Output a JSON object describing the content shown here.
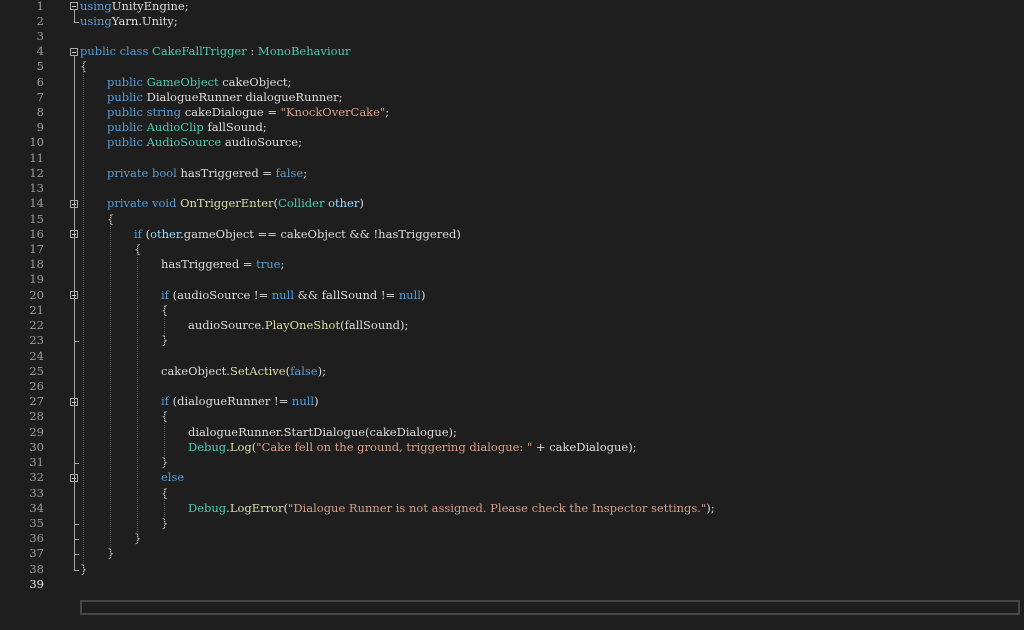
{
  "editor": {
    "current_line": 39,
    "colors": {
      "background": "#1e1e1e",
      "keyword": "#569cd6",
      "type": "#4ec9b0",
      "method": "#dcdcaa",
      "string": "#d69d85",
      "parameter": "#9cdcfe",
      "text": "#dcdcdc",
      "line_number": "#9a9a9a"
    },
    "lines": [
      {
        "n": "1",
        "indent": 0,
        "tokens": [
          [
            "kw",
            "using"
          ],
          [
            "",
            "UnityEngine;"
          ]
        ]
      },
      {
        "n": "2",
        "indent": 0,
        "tokens": [
          [
            "kw",
            "using"
          ],
          [
            "",
            "Yarn.Unity;"
          ]
        ]
      },
      {
        "n": "3",
        "indent": 0,
        "tokens": []
      },
      {
        "n": "4",
        "indent": 0,
        "tokens": [
          [
            "kw",
            "public class "
          ],
          [
            "ty",
            "CakeFallTrigger"
          ],
          [
            "",
            " : "
          ],
          [
            "ty",
            "MonoBehaviour"
          ]
        ]
      },
      {
        "n": "5",
        "indent": 0,
        "tokens": [
          [
            "",
            "{"
          ]
        ]
      },
      {
        "n": "6",
        "indent": 1,
        "tokens": [
          [
            "kw",
            "public "
          ],
          [
            "ty",
            "GameObject"
          ],
          [
            "",
            " cakeObject;"
          ]
        ]
      },
      {
        "n": "7",
        "indent": 1,
        "tokens": [
          [
            "kw",
            "public "
          ],
          [
            "",
            "DialogueRunner dialogueRunner;"
          ]
        ]
      },
      {
        "n": "8",
        "indent": 1,
        "tokens": [
          [
            "kw",
            "public string "
          ],
          [
            "",
            "cakeDialogue = "
          ],
          [
            "st",
            "\"KnockOverCake\""
          ],
          [
            "",
            ";"
          ]
        ]
      },
      {
        "n": "9",
        "indent": 1,
        "tokens": [
          [
            "kw",
            "public "
          ],
          [
            "ty",
            "AudioClip"
          ],
          [
            "",
            " fallSound;"
          ]
        ]
      },
      {
        "n": "10",
        "indent": 1,
        "tokens": [
          [
            "kw",
            "public "
          ],
          [
            "ty",
            "AudioSource"
          ],
          [
            "",
            " audioSource;"
          ]
        ]
      },
      {
        "n": "11",
        "indent": 0,
        "tokens": []
      },
      {
        "n": "12",
        "indent": 1,
        "tokens": [
          [
            "kw",
            "private bool "
          ],
          [
            "",
            "hasTriggered = "
          ],
          [
            "kw",
            "false"
          ],
          [
            "",
            ";"
          ]
        ]
      },
      {
        "n": "13",
        "indent": 0,
        "tokens": []
      },
      {
        "n": "14",
        "indent": 1,
        "tokens": [
          [
            "kw",
            "private void "
          ],
          [
            "fn",
            "OnTriggerEnter"
          ],
          [
            "",
            "("
          ],
          [
            "ty",
            "Collider"
          ],
          [
            "",
            " "
          ],
          [
            "pa",
            "other"
          ],
          [
            "",
            ")"
          ]
        ]
      },
      {
        "n": "15",
        "indent": 1,
        "tokens": [
          [
            "",
            "{"
          ]
        ]
      },
      {
        "n": "16",
        "indent": 2,
        "tokens": [
          [
            "kw",
            "if"
          ],
          [
            "",
            " ("
          ],
          [
            "pa",
            "other"
          ],
          [
            "",
            ".gameObject == cakeObject && !hasTriggered)"
          ]
        ]
      },
      {
        "n": "17",
        "indent": 2,
        "tokens": [
          [
            "",
            "{"
          ]
        ]
      },
      {
        "n": "18",
        "indent": 3,
        "tokens": [
          [
            "",
            "hasTriggered = "
          ],
          [
            "kw",
            "true"
          ],
          [
            "",
            ";"
          ]
        ]
      },
      {
        "n": "19",
        "indent": 0,
        "tokens": []
      },
      {
        "n": "20",
        "indent": 3,
        "tokens": [
          [
            "kw",
            "if"
          ],
          [
            "",
            " (audioSource != "
          ],
          [
            "kw",
            "null"
          ],
          [
            "",
            " && fallSound != "
          ],
          [
            "kw",
            "null"
          ],
          [
            "",
            ")"
          ]
        ]
      },
      {
        "n": "21",
        "indent": 3,
        "tokens": [
          [
            "",
            "{"
          ]
        ]
      },
      {
        "n": "22",
        "indent": 4,
        "tokens": [
          [
            "",
            "audioSource."
          ],
          [
            "fn",
            "PlayOneShot"
          ],
          [
            "",
            "(fallSound);"
          ]
        ]
      },
      {
        "n": "23",
        "indent": 3,
        "tokens": [
          [
            "",
            "}"
          ]
        ]
      },
      {
        "n": "24",
        "indent": 0,
        "tokens": []
      },
      {
        "n": "25",
        "indent": 3,
        "tokens": [
          [
            "",
            "cakeObject."
          ],
          [
            "fn",
            "SetActive"
          ],
          [
            "",
            "("
          ],
          [
            "kw",
            "false"
          ],
          [
            "",
            ");"
          ]
        ]
      },
      {
        "n": "26",
        "indent": 0,
        "tokens": []
      },
      {
        "n": "27",
        "indent": 3,
        "tokens": [
          [
            "kw",
            "if"
          ],
          [
            "",
            " (dialogueRunner != "
          ],
          [
            "kw",
            "null"
          ],
          [
            "",
            ")"
          ]
        ]
      },
      {
        "n": "28",
        "indent": 3,
        "tokens": [
          [
            "",
            "{"
          ]
        ]
      },
      {
        "n": "29",
        "indent": 4,
        "tokens": [
          [
            "",
            "dialogueRunner.StartDialogue(cakeDialogue);"
          ]
        ]
      },
      {
        "n": "30",
        "indent": 4,
        "tokens": [
          [
            "ty",
            "Debug"
          ],
          [
            "",
            "."
          ],
          [
            "fn",
            "Log"
          ],
          [
            "",
            "("
          ],
          [
            "st",
            "\"Cake fell on the ground, triggering dialogue: \""
          ],
          [
            "",
            " + cakeDialogue);"
          ]
        ]
      },
      {
        "n": "31",
        "indent": 3,
        "tokens": [
          [
            "",
            "}"
          ]
        ]
      },
      {
        "n": "32",
        "indent": 3,
        "tokens": [
          [
            "kw",
            "else"
          ]
        ]
      },
      {
        "n": "33",
        "indent": 3,
        "tokens": [
          [
            "",
            "{"
          ]
        ]
      },
      {
        "n": "34",
        "indent": 4,
        "tokens": [
          [
            "ty",
            "Debug"
          ],
          [
            "",
            "."
          ],
          [
            "fn",
            "LogError"
          ],
          [
            "",
            "("
          ],
          [
            "st",
            "\"Dialogue Runner is not assigned. Please check the Inspector settings.\""
          ],
          [
            "",
            ");"
          ]
        ]
      },
      {
        "n": "35",
        "indent": 3,
        "tokens": [
          [
            "",
            "}"
          ]
        ]
      },
      {
        "n": "36",
        "indent": 2,
        "tokens": [
          [
            "",
            "}"
          ]
        ]
      },
      {
        "n": "37",
        "indent": 1,
        "tokens": [
          [
            "",
            "}"
          ]
        ]
      },
      {
        "n": "38",
        "indent": 0,
        "tokens": [
          [
            "",
            "}"
          ]
        ]
      },
      {
        "n": "39",
        "indent": 0,
        "tokens": []
      }
    ]
  }
}
